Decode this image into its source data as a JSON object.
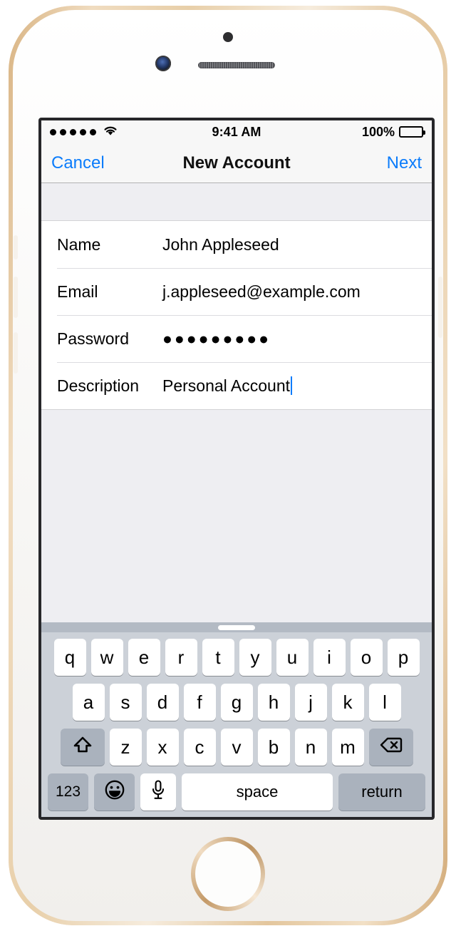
{
  "device": {
    "name": "iPhone",
    "finish": "gold-white",
    "home_button": "home-button"
  },
  "status_bar": {
    "signal_dots": 5,
    "wifi_icon": "wifi-icon",
    "time": "9:41 AM",
    "battery_percent": "100%",
    "battery_icon": "battery-full-icon"
  },
  "nav_bar": {
    "cancel_label": "Cancel",
    "title": "New Account",
    "next_label": "Next",
    "tint_color": "#0b7cfb"
  },
  "form": {
    "rows": [
      {
        "label": "Name",
        "value": "John Appleseed"
      },
      {
        "label": "Email",
        "value": "j.appleseed@example.com"
      },
      {
        "label": "Password",
        "value": "●●●●●●●●●"
      },
      {
        "label": "Description",
        "value": "Personal Account"
      }
    ],
    "focused_row": "Description"
  },
  "keyboard": {
    "layout": "qwerty-lowercase",
    "handle": "drag-handle",
    "row1": [
      "q",
      "w",
      "e",
      "r",
      "t",
      "y",
      "u",
      "i",
      "o",
      "p"
    ],
    "row2": [
      "a",
      "s",
      "d",
      "f",
      "g",
      "h",
      "j",
      "k",
      "l"
    ],
    "row3": [
      "z",
      "x",
      "c",
      "v",
      "b",
      "n",
      "m"
    ],
    "shift_icon": "shift-icon",
    "delete_icon": "delete-icon",
    "numbers_label": "123",
    "emoji_icon": "emoji-icon",
    "dictation_icon": "microphone-icon",
    "space_label": "space",
    "return_label": "return",
    "key_color": "#ffffff",
    "modifier_key_color": "#aab2bd",
    "background_color": "#ccd1d8"
  }
}
